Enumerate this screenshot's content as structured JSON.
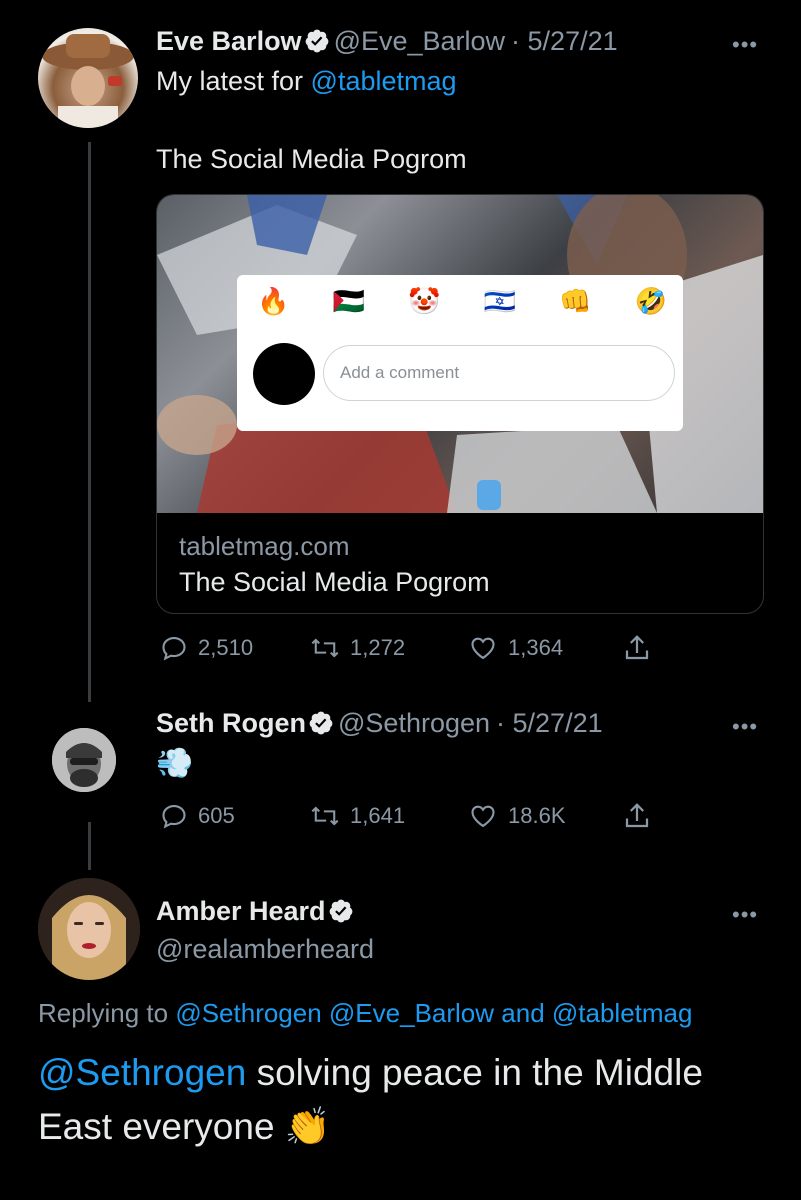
{
  "tweet1": {
    "name": "Eve Barlow",
    "handle": "@Eve_Barlow",
    "date": "· 5/27/21",
    "text_prefix": "My latest for ",
    "mention": "@tabletmag",
    "headline": "The Social Media Pogrom",
    "card": {
      "domain": "tabletmag.com",
      "title": "The Social Media Pogrom",
      "overlay_placeholder": "Add a comment",
      "reactions": [
        "🔥",
        "🇵🇸",
        "🤡",
        "🇮🇱",
        "👊",
        "🤣"
      ]
    },
    "replies": "2,510",
    "retweets": "1,272",
    "likes": "1,364"
  },
  "tweet2": {
    "name": "Seth Rogen",
    "handle": "@Sethrogen",
    "date": "· 5/27/21",
    "emoji": "💨",
    "replies": "605",
    "retweets": "1,641",
    "likes": "18.6K"
  },
  "tweet3": {
    "name": "Amber Heard",
    "handle": "@realamberheard",
    "replying_prefix": "Replying to ",
    "replying_to": "@Sethrogen @Eve_Barlow",
    "replying_and": " and ",
    "replying_last": "@tabletmag",
    "mention": "@Sethrogen",
    "text": " solving peace in the Middle East everyone ",
    "emoji": "👏"
  },
  "more_label": "•••",
  "colors": {
    "background": "#000000",
    "link": "#1d9bf0",
    "muted": "#8b98a5",
    "verified": "#e7e9ea"
  }
}
